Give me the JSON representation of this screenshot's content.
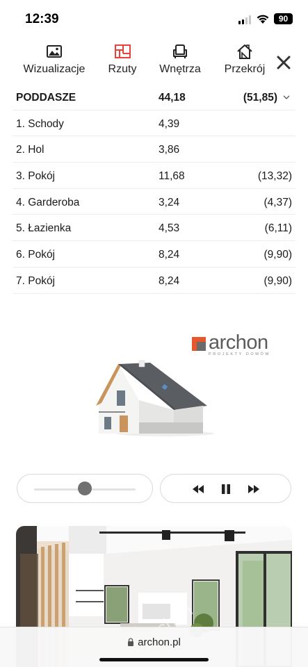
{
  "status": {
    "time": "12:39",
    "battery": "90"
  },
  "tabs": [
    {
      "label": "Wizualizacje",
      "icon": "image-icon"
    },
    {
      "label": "Rzuty",
      "icon": "floor-plan-icon",
      "active": true
    },
    {
      "label": "Wnętrza",
      "icon": "armchair-icon"
    },
    {
      "label": "Przekrój",
      "icon": "house-section-icon"
    }
  ],
  "accent_color": "#e8423a",
  "rooms": {
    "header": {
      "name": "PODDASZE",
      "area": "44,18",
      "total": "(51,85)"
    },
    "rows": [
      {
        "name": "1. Schody",
        "area": "4,39",
        "total": ""
      },
      {
        "name": "2. Hol",
        "area": "3,86",
        "total": ""
      },
      {
        "name": "3. Pokój",
        "area": "11,68",
        "total": "(13,32)"
      },
      {
        "name": "4. Garderoba",
        "area": "3,24",
        "total": "(4,37)"
      },
      {
        "name": "5. Łazienka",
        "area": "4,53",
        "total": "(6,11)"
      },
      {
        "name": "6. Pokój",
        "area": "8,24",
        "total": "(9,90)"
      },
      {
        "name": "7. Pokój",
        "area": "8,24",
        "total": "(9,90)"
      }
    ]
  },
  "logo": {
    "word": "archon",
    "tagline": "PROJEKTY DOMÓW",
    "brand_color": "#e8572a"
  },
  "player": {
    "position": 0.5
  },
  "url": "archon.pl"
}
